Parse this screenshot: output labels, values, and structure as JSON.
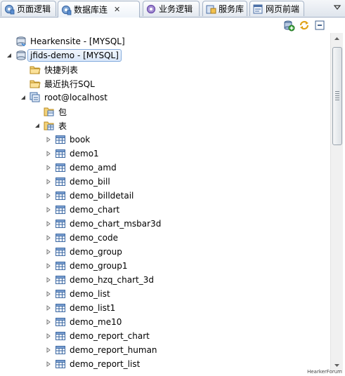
{
  "tabs": [
    {
      "label": "页面逻辑",
      "icon": "gear-icon",
      "active": false
    },
    {
      "label": "数据库连",
      "icon": "gear-icon",
      "active": true,
      "close": "✕"
    },
    {
      "label": "业务逻辑",
      "icon": "gear-puzzle-icon",
      "active": false
    },
    {
      "label": "服务库",
      "icon": "service-icon",
      "active": false
    },
    {
      "label": "网页前端",
      "icon": "webpage-icon",
      "active": false
    }
  ],
  "tree": {
    "connections": [
      {
        "label": "Hearkensite - [MYSQL]"
      },
      {
        "label": "jfids-demo - [MYSQL]"
      }
    ],
    "folders": {
      "shortcuts": "快捷列表",
      "recent_sql": "最近执行SQL"
    },
    "schema": "root@localhost",
    "package": "包",
    "tables_node": "表",
    "tables": [
      "book",
      "demo1",
      "demo_amd",
      "demo_bill",
      "demo_billdetail",
      "demo_chart",
      "demo_chart_msbar3d",
      "demo_code",
      "demo_group",
      "demo_group1",
      "demo_hzq_chart_3d",
      "demo_list",
      "demo_list1",
      "demo_me10",
      "demo_report_chart",
      "demo_report_human",
      "demo_report_list"
    ]
  },
  "watermark": "HearkerForum",
  "colors": {
    "selection_border": "#84acdd",
    "selection_fill": "#d9e7f9",
    "tab_border": "#a6b4c7"
  }
}
